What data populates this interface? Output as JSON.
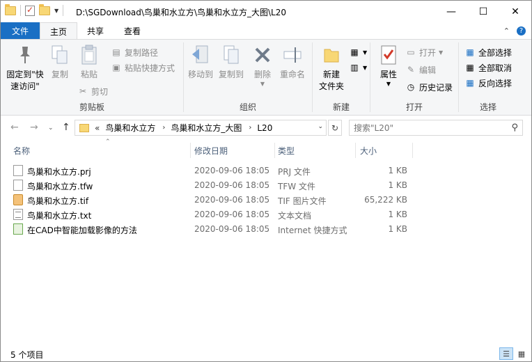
{
  "window": {
    "title": "D:\\SGDownload\\鸟巢和水立方\\鸟巢和水立方_大图\\L20",
    "minimize": "—",
    "maximize": "☐",
    "close": "✕"
  },
  "tabs": {
    "file": "文件",
    "home": "主页",
    "share": "共享",
    "view": "查看"
  },
  "ribbon": {
    "pin_quick_access": "固定到\"快速访问\"",
    "copy": "复制",
    "paste": "粘贴",
    "copy_path": "复制路径",
    "paste_shortcut": "粘贴快捷方式",
    "cut": "剪切",
    "clipboard_group": "剪贴板",
    "move_to": "移动到",
    "copy_to": "复制到",
    "delete": "删除",
    "rename": "重命名",
    "organize_group": "组织",
    "new_folder": "新建\n文件夹",
    "new_group": "新建",
    "properties": "属性",
    "open": "打开",
    "edit": "编辑",
    "history": "历史记录",
    "open_group": "打开",
    "select_all": "全部选择",
    "select_none": "全部取消",
    "invert_selection": "反向选择",
    "select_group": "选择"
  },
  "address": {
    "crumbs": [
      "鸟巢和水立方",
      "鸟巢和水立方_大图",
      "L20"
    ],
    "overflow": "«"
  },
  "search": {
    "placeholder": "搜索\"L20\""
  },
  "columns": {
    "name": "名称",
    "date": "修改日期",
    "type": "类型",
    "size": "大小"
  },
  "files": [
    {
      "name": "鸟巢和水立方.prj",
      "date": "2020-09-06 18:05",
      "type": "PRJ 文件",
      "size": "1 KB"
    },
    {
      "name": "鸟巢和水立方.tfw",
      "date": "2020-09-06 18:05",
      "type": "TFW 文件",
      "size": "1 KB"
    },
    {
      "name": "鸟巢和水立方.tif",
      "date": "2020-09-06 18:05",
      "type": "TIF 图片文件",
      "size": "65,222 KB"
    },
    {
      "name": "鸟巢和水立方.txt",
      "date": "2020-09-06 18:05",
      "type": "文本文档",
      "size": "1 KB"
    },
    {
      "name": "在CAD中智能加载影像的方法",
      "date": "2020-09-06 18:05",
      "type": "Internet 快捷方式",
      "size": "1 KB"
    }
  ],
  "status": {
    "item_count": "5 个项目"
  }
}
